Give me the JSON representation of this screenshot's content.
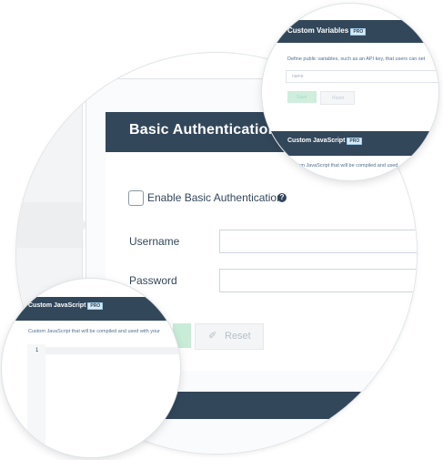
{
  "main_panel": {
    "title": "Basic Authentication",
    "enable_checkbox_label": "Enable Basic Authentication",
    "help_icon": "?",
    "username_label": "Username",
    "password_label": "Password",
    "reset_button_label": "Reset",
    "reset_icon": "✐"
  },
  "custom_variables_panel": {
    "title": "Custom Variables",
    "pro_badge": "PRO",
    "description": "Define public variables, such as an API key, that users can set",
    "name_placeholder": "name",
    "save_button_label": "Save",
    "reset_button_label": "Reset"
  },
  "custom_js_panel_top": {
    "title": "Custom JavaScript",
    "pro_badge": "PRO",
    "description": "Custom JavaScript that will be compiled and used"
  },
  "custom_js_panel_bottom": {
    "title": "Custom JavaScript",
    "pro_badge": "PRO",
    "description": "Custom JavaScript that will be compiled and used with your",
    "editor_line_number": "1"
  },
  "colors": {
    "header_navy": "#33475b",
    "pro_badge_bg": "#d6ebf7",
    "save_green": "#c9ecd9"
  }
}
